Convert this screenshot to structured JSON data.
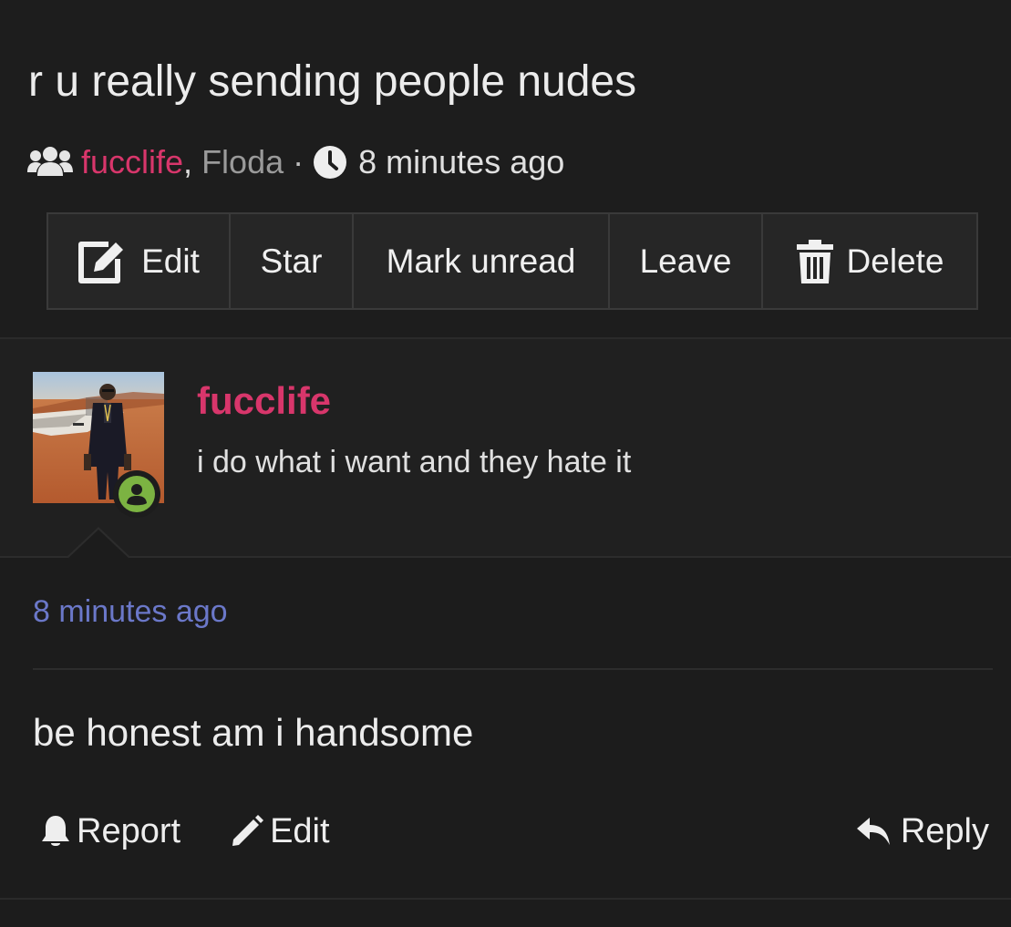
{
  "conversation": {
    "title": "r u really sending people nudes",
    "participants": [
      "fucclife",
      "Floda"
    ],
    "participant_separator": ",",
    "meta_separator": "·",
    "time": "8 minutes ago"
  },
  "toolbar": {
    "edit_label": "Edit",
    "star_label": "Star",
    "mark_unread_label": "Mark unread",
    "leave_label": "Leave",
    "delete_label": "Delete"
  },
  "message": {
    "author": "fucclife",
    "user_status": "i do what i want and they hate it",
    "time": "8 minutes ago",
    "body": "be honest am i handsome"
  },
  "actions": {
    "report_label": "Report",
    "edit_label": "Edit",
    "reply_label": "Reply"
  },
  "colors": {
    "username_accent": "#d8366b",
    "timestamp_link": "#6b78c9",
    "online_badge": "#7cb342"
  },
  "icons": [
    "users-icon",
    "clock-icon",
    "edit-icon",
    "trash-icon",
    "user-online-icon",
    "bell-icon",
    "pencil-icon",
    "reply-icon"
  ]
}
